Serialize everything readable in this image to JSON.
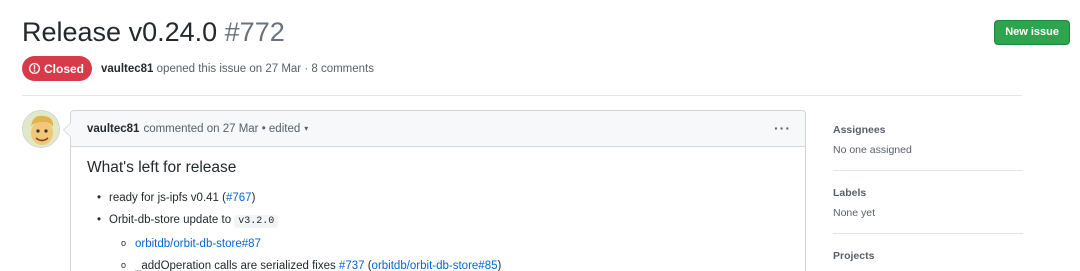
{
  "issue": {
    "title": "Release v0.24.0",
    "number": "#772",
    "state": "Closed",
    "author": "vaultec81",
    "meta": "opened this issue on 27 Mar · 8 comments"
  },
  "header": {
    "new_issue_label": "New issue"
  },
  "comment": {
    "author": "vaultec81",
    "meta": "commented on 27 Mar • edited",
    "caret": "▾",
    "kebab": "···",
    "heading": "What's left for release",
    "items": [
      {
        "text": "ready for js-ipfs v0.41 (",
        "link": "#767",
        "after": ")"
      },
      {
        "text": "Orbit-db-store update to ",
        "code": "v3.2.0"
      }
    ],
    "subitems": [
      {
        "link": "orbitdb/orbit-db-store#87"
      },
      {
        "text": "_addOperation calls are serialized fixes ",
        "link1": "#737",
        "mid": " (",
        "link2": "orbitdb/orbit-db-store#85",
        "after": ")"
      }
    ]
  },
  "sidebar": {
    "assignees": {
      "label": "Assignees",
      "value": "No one assigned"
    },
    "labels": {
      "label": "Labels",
      "value": "None yet"
    },
    "projects": {
      "label": "Projects"
    }
  },
  "colors": {
    "closed": "#d73a49",
    "new_issue": "#2ea44f",
    "link": "#0366d6"
  },
  "icons": {
    "state": "issue-closed-icon",
    "avatar": "vault-boy-avatar"
  }
}
